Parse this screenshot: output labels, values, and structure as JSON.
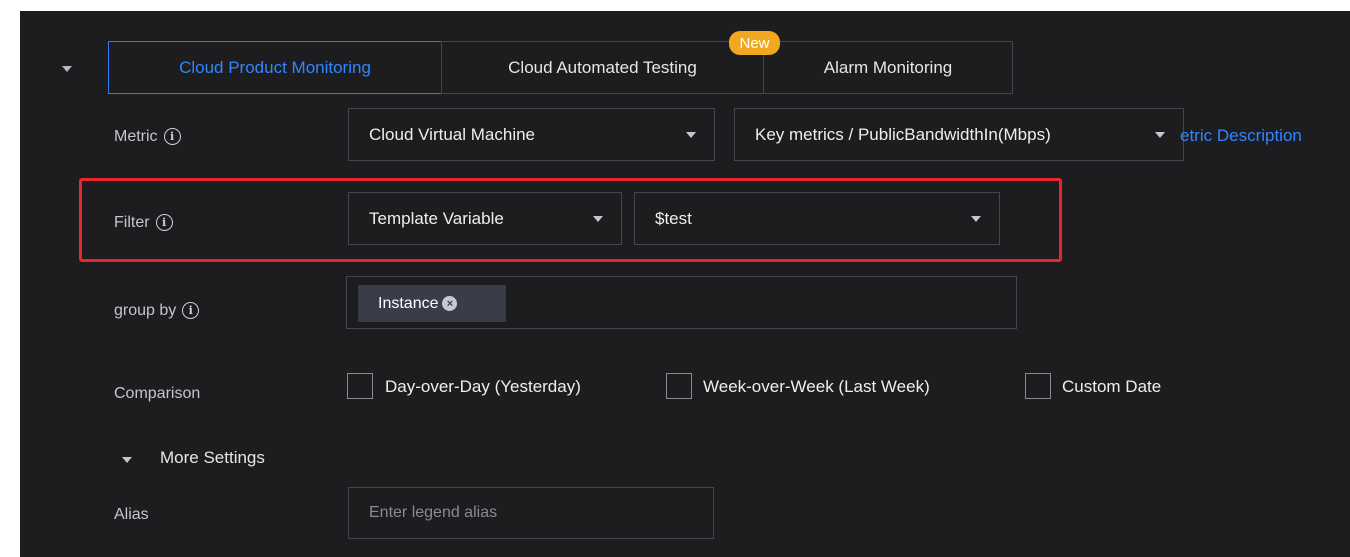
{
  "tabs": [
    {
      "label": "Cloud Product Monitoring",
      "active": true
    },
    {
      "label": "Cloud Automated Testing",
      "badge": "New"
    },
    {
      "label": "Alarm Monitoring"
    }
  ],
  "metric": {
    "label": "Metric",
    "product_select": "Cloud Virtual Machine",
    "metric_select": "Key metrics / PublicBandwidthIn(Mbps)",
    "description_link": "etric Description"
  },
  "filter": {
    "label": "Filter",
    "type_select": "Template Variable",
    "value_select": "$test"
  },
  "group_by": {
    "label": "group by",
    "tags": [
      "Instance"
    ]
  },
  "comparison": {
    "label": "Comparison",
    "options": [
      {
        "label": "Day-over-Day (Yesterday)",
        "checked": false
      },
      {
        "label": "Week-over-Week (Last Week)",
        "checked": false
      },
      {
        "label": "Custom Date",
        "checked": false
      }
    ]
  },
  "more_settings": {
    "label": "More Settings"
  },
  "alias": {
    "label": "Alias",
    "placeholder": "Enter legend alias",
    "value": ""
  },
  "colors": {
    "accent": "#2f86ff",
    "badge": "#f1a81e",
    "highlight": "#e8262b",
    "background": "#1d1d20"
  },
  "icons": {
    "info": "info-circle-icon",
    "caret": "caret-down-icon",
    "tag_remove": "close-circle-icon"
  }
}
